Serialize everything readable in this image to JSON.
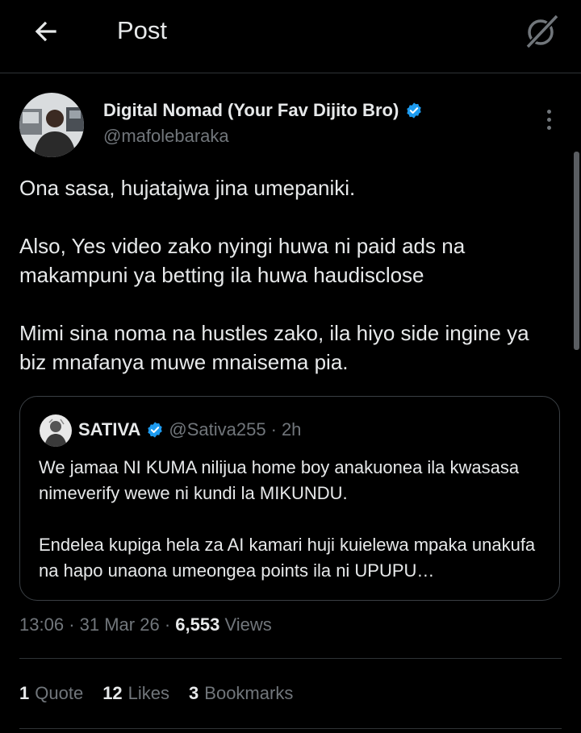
{
  "header": {
    "back_icon": "arrow-left-icon",
    "title": "Post",
    "grok_icon": "grok-slash-icon"
  },
  "author": {
    "name": "Digital Nomad (Your Fav Dijito Bro)",
    "handle": "@mafolebaraka",
    "verified_icon": "verified-badge-icon",
    "verified_color": "#1d9bf0"
  },
  "post": {
    "paragraphs": [
      "Ona sasa, hujatajwa jina umepaniki.",
      "Also, Yes video zako nyingi huwa ni paid ads na makampuni ya betting ila huwa haudisclose",
      "Mimi sina noma na hustles zako, ila hiyo side ingine ya biz mnafanya muwe mnaisema pia."
    ],
    "time": "13:06",
    "date": "31 Mar 26",
    "views_count": "6,553",
    "views_label": "Views"
  },
  "quoted": {
    "name": "SATIVA",
    "handle": "@Sativa255",
    "separator": "·",
    "time": "2h",
    "paragraphs": [
      "We jamaa NI KUMA nilijua home boy anakuonea ila kwasasa nimeverify wewe ni kundi la MIKUNDU.",
      "Endelea kupiga hela za AI kamari huji kuielewa mpaka unakufa na hapo unaona umeongea points ila ni UPUPU…"
    ]
  },
  "stats": {
    "quotes_count": "1",
    "quotes_label": "Quote",
    "likes_count": "12",
    "likes_label": "Likes",
    "bookmarks_count": "3",
    "bookmarks_label": "Bookmarks"
  },
  "colors": {
    "background": "#000000",
    "text_primary": "#e7e9ea",
    "text_secondary": "#71767b",
    "border": "#2f3336",
    "accent": "#1d9bf0"
  }
}
